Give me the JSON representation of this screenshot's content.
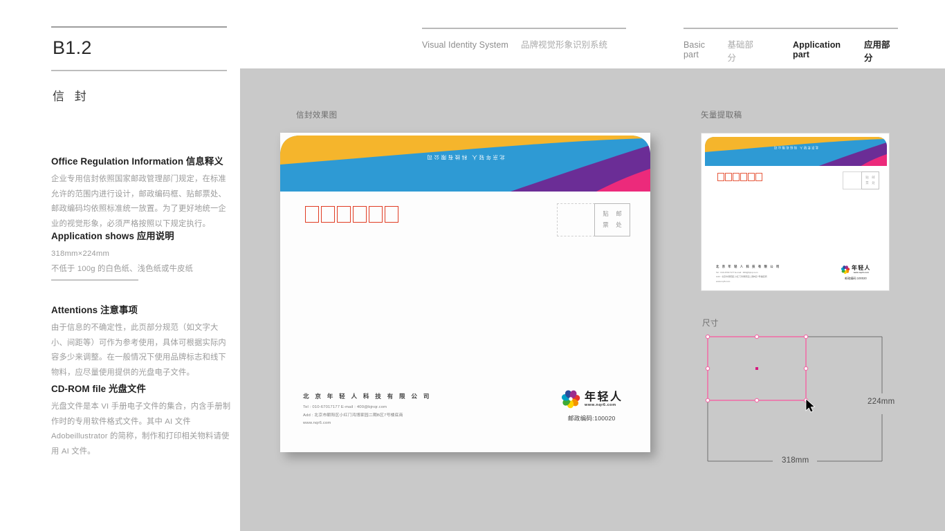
{
  "header": {
    "left_group": {
      "en": "Visual Identity System",
      "cn": "品牌视觉形象识别系统"
    },
    "right_group": {
      "basic_en": "Basic part",
      "basic_cn": "基础部分",
      "app_en": "Application part",
      "app_cn": "应用部分"
    }
  },
  "sidebar": {
    "code": "B1.2",
    "title": "信 封",
    "sections": [
      {
        "heading": "Office Regulation Information 信息释义",
        "body": "企业专用信封依照国家邮政管理部门规定，在标准允许的范围内进行设计，邮政编码框、贴邮票处、邮政编码均依照标准统一放置。为了更好地统一企业的视觉形象，必须严格按照以下规定执行。"
      },
      {
        "heading": "Application shows 应用说明",
        "line1": "318mm×224mm",
        "line2": "不低于 100g 的白色纸、浅色纸或牛皮纸"
      },
      {
        "heading": "Attentions 注意事项",
        "body": "由于信息的不确定性，此页部分规范（如文字大小、间距等）可作为参考使用，具体可根据实际内容多少来调整。在一般情况下使用品牌标志和线下物料，应尽量使用提供的光盘电子文件。"
      },
      {
        "heading": "CD-ROM file 光盘文件",
        "body": "光盘文件是本 VI 手册电子文件的集合，内含手册制作时的专用软件格式文件。其中 AI 文件 Adobeillustrator 的简称，制作和打印相关物料请使用 AI 文件。"
      }
    ]
  },
  "stage": {
    "caption_mockup": "信封效果图",
    "caption_vector": "矢量提取稿",
    "caption_dimension": "尺寸"
  },
  "envelope": {
    "flap_text": "北京年轻人 科技有限公司",
    "postal_boxes": 6,
    "stamp_label": [
      "贴",
      "邮",
      "票",
      "处"
    ],
    "company": "北 京 年 轻 人 科 技 有 限 公 司",
    "tel": "Tel : 010-67017177   E-mail : 400@bjnqr.com",
    "address": "Add : 北京市朝阳区小红门鸿博家园二期B区7号楼底商",
    "website": "www.nqr6.com",
    "logo_cn": "年轻人",
    "logo_url": "www.nqr6.com",
    "postcode": "邮政编码:100020"
  },
  "dimension": {
    "width_label": "318mm",
    "height_label": "224mm"
  },
  "colors": {
    "yellow": "#f5b52c",
    "blue": "#2e9ad4",
    "purple": "#6b2d96",
    "magenta": "#ec2a7b",
    "red_box": "#e03b22",
    "stage_gray": "#c9c9c9",
    "selection_pink": "#f06fa8"
  }
}
